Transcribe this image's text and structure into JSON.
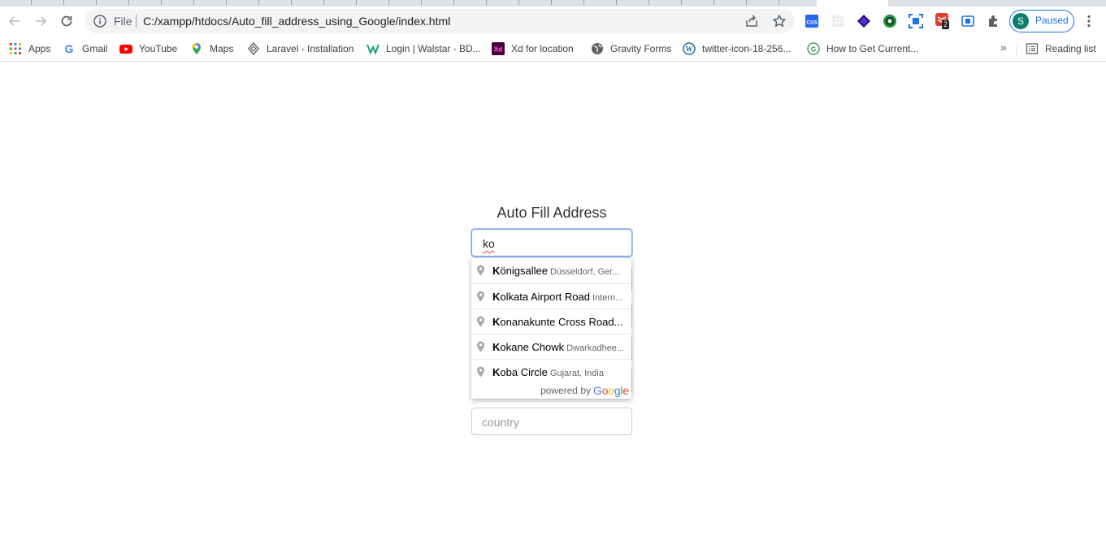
{
  "browser": {
    "omnibox": {
      "scheme_label": "File",
      "url": "C:/xampp/htdocs/Auto_fill_address_using_Google/index.html"
    },
    "profile": {
      "initial": "S",
      "status": "Paused"
    },
    "extension_badge": "2"
  },
  "bookmarks": [
    {
      "label": "Apps",
      "icon": "apps-grid-icon"
    },
    {
      "label": "Gmail",
      "icon": "google-icon"
    },
    {
      "label": "YouTube",
      "icon": "youtube-icon"
    },
    {
      "label": "Maps",
      "icon": "maps-pin-icon"
    },
    {
      "label": "Laravel - Installation",
      "icon": "laravel-icon"
    },
    {
      "label": "Login | Walstar - BD...",
      "icon": "walstar-icon"
    },
    {
      "label": "Xd for location",
      "icon": "xd-icon"
    },
    {
      "label": "Gravity Forms",
      "icon": "globe-icon"
    },
    {
      "label": "twitter-icon-18-256...",
      "icon": "wordpress-icon"
    },
    {
      "label": "How to Get Current...",
      "icon": "geeks-icon"
    }
  ],
  "reading_list": {
    "label": "Reading list"
  },
  "page": {
    "title": "Auto Fill Address",
    "search": {
      "value": "ko"
    },
    "country": {
      "placeholder": "country"
    }
  },
  "autocomplete": {
    "suggestions": [
      {
        "match": "K",
        "rest": "önigsallee",
        "secondary": "Düsseldorf, Ger..."
      },
      {
        "match": "K",
        "rest": "olkata Airport Road",
        "secondary": "Intern..."
      },
      {
        "match": "K",
        "rest": "onanakunte Cross Road...",
        "secondary": ""
      },
      {
        "match": "K",
        "rest": "okane Chowk",
        "secondary": "Dwarkadhee..."
      },
      {
        "match": "K",
        "rest": "oba Circle",
        "secondary": "Gujarat, India"
      }
    ],
    "powered_by": "powered by",
    "google_logo": "Google"
  },
  "colors": {
    "accent": "#1a73e8",
    "focus_border": "#7fa8e8",
    "profile_avatar": "#0d7d6c"
  }
}
